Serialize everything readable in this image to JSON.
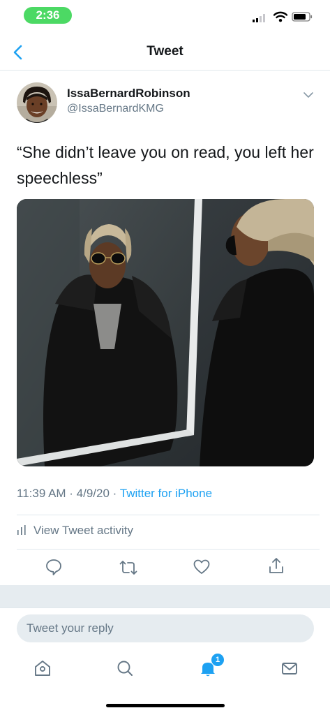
{
  "status_bar": {
    "time": "2:36"
  },
  "nav": {
    "title": "Tweet"
  },
  "tweet": {
    "author": {
      "display_name": "IssaBernardRobinson",
      "handle": "@IssaBernardKMG"
    },
    "text": "“She didn’t leave you on read, you left her speechless”",
    "timestamp": "11:39 AM · 4/9/20 · ",
    "source": "Twitter for iPhone",
    "activity_label": "View Tweet activity"
  },
  "reply": {
    "placeholder": "Tweet your reply"
  },
  "tab_bar": {
    "notification_count": "1"
  },
  "colors": {
    "accent": "#1da1f2",
    "secondary_text": "#657786",
    "divider": "#e1e8ed",
    "status_time_bg": "#4cd964"
  },
  "icons": {
    "back": "chevron-left-icon",
    "caret": "chevron-down-icon",
    "reply": "speech-bubble-icon",
    "retweet": "retweet-icon",
    "like": "heart-icon",
    "share": "share-icon",
    "home": "home-icon",
    "search": "search-icon",
    "notifications": "bell-icon",
    "messages": "envelope-icon"
  }
}
